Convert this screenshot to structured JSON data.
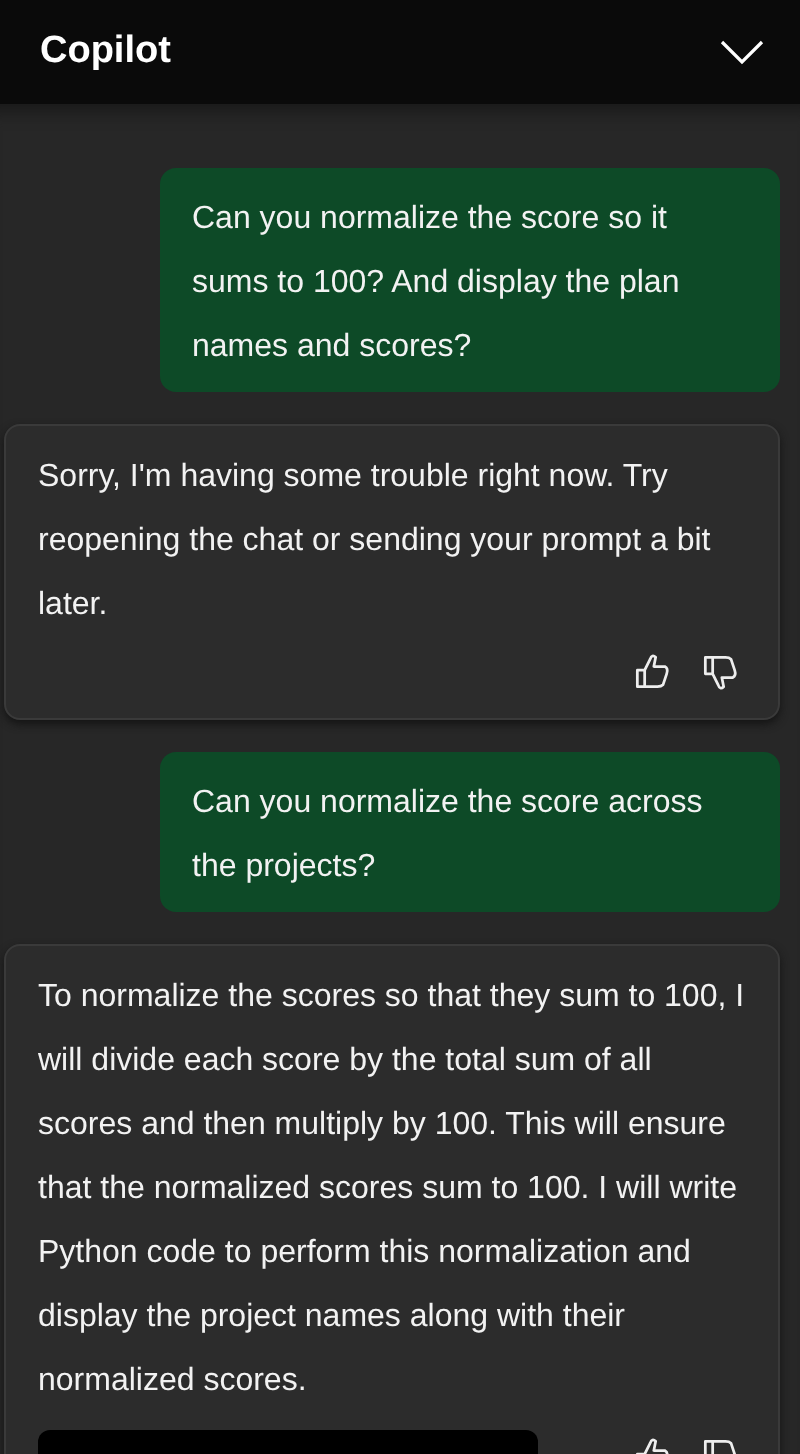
{
  "header": {
    "title": "Copilot"
  },
  "messages": [
    {
      "kind": "user",
      "text": "Can you normalize the score so it sums to 100? And display the plan names and scores?"
    },
    {
      "kind": "assistant",
      "text": "Sorry, I'm having some trouble right now. Try reopening the chat or sending your prompt a bit later.",
      "feedback": true,
      "code_block": false
    },
    {
      "kind": "user",
      "text": "Can you normalize the score across the projects?"
    },
    {
      "kind": "assistant",
      "text": "To normalize the scores so that they sum to 100, I will divide each score by the total sum of all scores and then multiply by 100. This will ensure that the normalized scores sum to 100. I will write Python code to perform this normalization and display the project names along with their normalized scores.",
      "feedback": true,
      "code_block": true
    }
  ]
}
